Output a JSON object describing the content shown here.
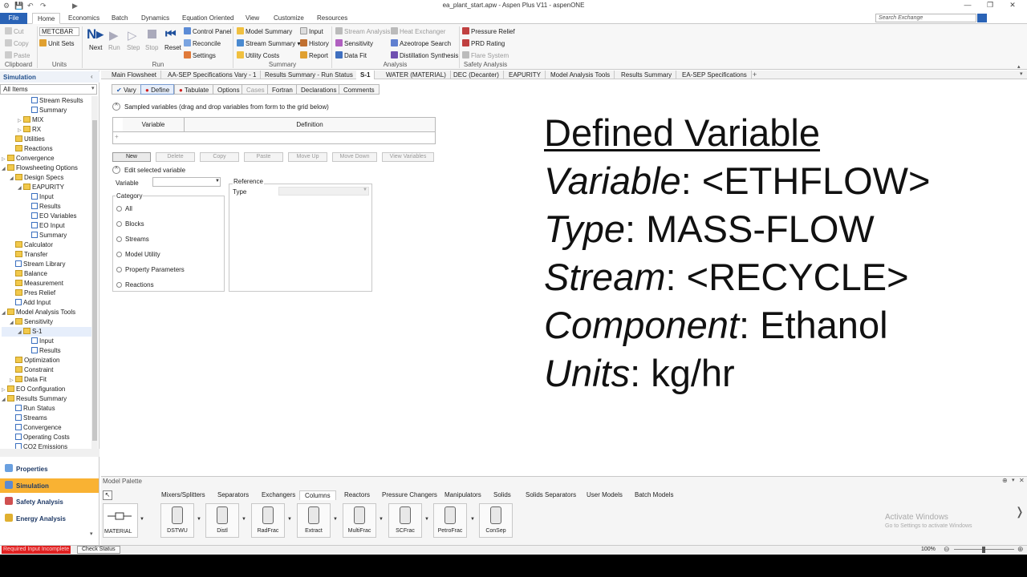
{
  "window": {
    "title": "ea_plant_start.apw - Aspen Plus V11 - aspenONE",
    "controls": [
      "—",
      "❐",
      "✕"
    ]
  },
  "menu": {
    "tabs": [
      "File",
      "Home",
      "Economics",
      "Batch",
      "Dynamics",
      "Equation Oriented",
      "View",
      "Customize",
      "Resources"
    ],
    "active": "Home",
    "search_placeholder": "Search Exchange"
  },
  "ribbon": {
    "clipboard": {
      "cut": "Cut",
      "copy": "Copy",
      "paste": "Paste",
      "group": "Clipboard"
    },
    "units": {
      "unit_set": "METCBAR",
      "unit_sets": "Unit Sets",
      "group": "Units"
    },
    "run": {
      "next": "Next",
      "run": "Run",
      "step": "Step",
      "stop": "Stop",
      "reset": "Reset",
      "control_panel": "Control Panel",
      "reconcile": "Reconcile",
      "settings": "Settings",
      "group": "Run"
    },
    "summary": {
      "model_summary": "Model Summary",
      "stream_summary": "Stream Summary",
      "utility_costs": "Utility Costs",
      "input": "Input",
      "history": "History",
      "report": "Report",
      "group": "Summary"
    },
    "analysis": {
      "stream_analysis": "Stream Analysis",
      "sensitivity": "Sensitivity",
      "data_fit": "Data Fit",
      "heat_exchanger": "Heat Exchanger",
      "azeotrope_search": "Azeotrope Search",
      "distillation_synthesis": "Distillation Synthesis",
      "group": "Analysis"
    },
    "safety": {
      "pressure_relief": "Pressure Relief",
      "prd_rating": "PRD Rating",
      "flare_system": "Flare System",
      "group": "Safety Analysis"
    }
  },
  "nav": {
    "header": "Simulation",
    "filter": "All Items",
    "tree": [
      {
        "label": "Stream Results",
        "indent": 3,
        "icon": "doc"
      },
      {
        "label": "Summary",
        "indent": 3,
        "icon": "doc"
      },
      {
        "label": "MIX",
        "indent": 2,
        "icon": "folder",
        "arrow": "▷"
      },
      {
        "label": "RX",
        "indent": 2,
        "icon": "folder",
        "arrow": "▷"
      },
      {
        "label": "Utilities",
        "indent": 1,
        "icon": "folder"
      },
      {
        "label": "Reactions",
        "indent": 1,
        "icon": "folder"
      },
      {
        "label": "Convergence",
        "indent": 0,
        "icon": "folder",
        "arrow": "▷"
      },
      {
        "label": "Flowsheeting Options",
        "indent": 0,
        "icon": "folder",
        "arrow": "◢"
      },
      {
        "label": "Design Specs",
        "indent": 1,
        "icon": "folder",
        "arrow": "◢"
      },
      {
        "label": "EAPURITY",
        "indent": 2,
        "icon": "folder",
        "arrow": "◢"
      },
      {
        "label": "Input",
        "indent": 3,
        "icon": "doc"
      },
      {
        "label": "Results",
        "indent": 3,
        "icon": "doc"
      },
      {
        "label": "EO Variables",
        "indent": 3,
        "icon": "doc"
      },
      {
        "label": "EO Input",
        "indent": 3,
        "icon": "doc"
      },
      {
        "label": "Summary",
        "indent": 3,
        "icon": "doc"
      },
      {
        "label": "Calculator",
        "indent": 1,
        "icon": "folder"
      },
      {
        "label": "Transfer",
        "indent": 1,
        "icon": "folder"
      },
      {
        "label": "Stream Library",
        "indent": 1,
        "icon": "doc"
      },
      {
        "label": "Balance",
        "indent": 1,
        "icon": "folder"
      },
      {
        "label": "Measurement",
        "indent": 1,
        "icon": "folder"
      },
      {
        "label": "Pres Relief",
        "indent": 1,
        "icon": "folder"
      },
      {
        "label": "Add Input",
        "indent": 1,
        "icon": "doc"
      },
      {
        "label": "Model Analysis Tools",
        "indent": 0,
        "icon": "folder",
        "arrow": "◢"
      },
      {
        "label": "Sensitivity",
        "indent": 1,
        "icon": "folder",
        "arrow": "◢"
      },
      {
        "label": "S-1",
        "indent": 2,
        "icon": "folder",
        "arrow": "◢"
      },
      {
        "label": "Input",
        "indent": 3,
        "icon": "doc"
      },
      {
        "label": "Results",
        "indent": 3,
        "icon": "doc"
      },
      {
        "label": "Optimization",
        "indent": 1,
        "icon": "folder"
      },
      {
        "label": "Constraint",
        "indent": 1,
        "icon": "folder"
      },
      {
        "label": "Data Fit",
        "indent": 1,
        "icon": "folder",
        "arrow": "▷"
      },
      {
        "label": "EO Configuration",
        "indent": 0,
        "icon": "folder",
        "arrow": "▷"
      },
      {
        "label": "Results Summary",
        "indent": 0,
        "icon": "folder",
        "arrow": "◢"
      },
      {
        "label": "Run Status",
        "indent": 1,
        "icon": "doc"
      },
      {
        "label": "Streams",
        "indent": 1,
        "icon": "doc"
      },
      {
        "label": "Convergence",
        "indent": 1,
        "icon": "doc"
      },
      {
        "label": "Operating Costs",
        "indent": 1,
        "icon": "doc"
      },
      {
        "label": "CO2 Emissions",
        "indent": 1,
        "icon": "doc"
      }
    ],
    "bottom": [
      "Properties",
      "Simulation",
      "Safety Analysis",
      "Energy Analysis"
    ],
    "bottom_selected": "Simulation"
  },
  "doc_tabs": [
    "Main Flowsheet",
    "AA-SEP Specifications Vary - 1",
    "Results Summary - Run Status",
    "S-1",
    "WATER (MATERIAL)",
    "DEC (Decanter)",
    "EAPURITY",
    "Model Analysis Tools",
    "Results Summary",
    "EA-SEP Specifications"
  ],
  "doc_tab_active": "S-1",
  "form_tabs": [
    "Vary",
    "Define",
    "Tabulate",
    "Options",
    "Cases",
    "Fortran",
    "Declarations",
    "Comments"
  ],
  "form": {
    "sampled_header": "Sampled variables (drag and drop variables from form to the grid below)",
    "col_variable": "Variable",
    "col_definition": "Definition",
    "buttons": [
      "New",
      "Delete",
      "Copy",
      "Paste",
      "Move Up",
      "Move Down",
      "View Variables"
    ],
    "edit_header": "Edit selected variable",
    "variable_label": "Variable",
    "category_label": "Category",
    "categories": [
      "All",
      "Blocks",
      "Streams",
      "Model Utility",
      "Property Parameters",
      "Reactions"
    ],
    "reference_label": "Reference",
    "type_label": "Type"
  },
  "overlay": {
    "title": "Defined Variable",
    "lines": [
      {
        "key": "Variable",
        "value": ": <ETHFLOW>"
      },
      {
        "key": "Type",
        "value": ": MASS-FLOW"
      },
      {
        "key": "Stream",
        "value": ": <RECYCLE>"
      },
      {
        "key": "Component",
        "value": ": Ethanol"
      },
      {
        "key": "Units",
        "value": ": kg/hr"
      }
    ]
  },
  "palette": {
    "title": "Model Palette",
    "tabs": [
      "Mixers/Splitters",
      "Separators",
      "Exchangers",
      "Columns",
      "Reactors",
      "Pressure Changers",
      "Manipulators",
      "Solids",
      "Solids Separators",
      "User Models",
      "Batch Models"
    ],
    "active": "Columns",
    "material": "MATERIAL",
    "items": [
      "DSTWU",
      "Distl",
      "RadFrac",
      "Extract",
      "MultiFrac",
      "SCFrac",
      "PetroFrac",
      "ConSep"
    ],
    "watermark_title": "Activate Windows",
    "watermark_sub": "Go to Settings to activate Windows"
  },
  "status": {
    "error": "Required Input Incomplete",
    "check": "Check Status",
    "zoom": "100%"
  }
}
